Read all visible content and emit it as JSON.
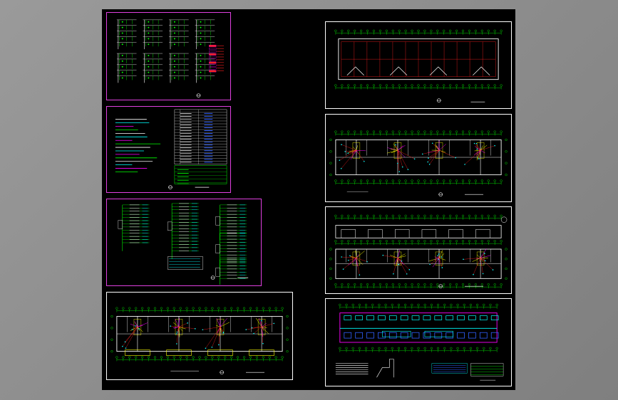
{
  "viewport": {
    "background_color": "#000000"
  },
  "colors": {
    "sheet_border_magenta": "#e040e0",
    "sheet_border_white": "#ffffff",
    "grid_green": "#00ff00",
    "wall_white": "#ffffff",
    "wire_red": "#ff2020",
    "wire_magenta": "#ff00ff",
    "wire_yellow": "#ffff00",
    "wire_cyan": "#00ffff",
    "wire_blue": "#3060ff"
  },
  "sheets": [
    {
      "id": "riser-diagram",
      "kind": "riser",
      "border": "magenta"
    },
    {
      "id": "legend-notes",
      "kind": "legend",
      "border": "magenta"
    },
    {
      "id": "distribution-boxes",
      "kind": "boxes",
      "border": "magenta"
    },
    {
      "id": "floor-plan-left",
      "kind": "plan",
      "border": "white"
    },
    {
      "id": "roof-plan",
      "kind": "roof",
      "border": "white"
    },
    {
      "id": "floor-plan-1",
      "kind": "plan",
      "border": "white"
    },
    {
      "id": "floor-plan-2",
      "kind": "plan2",
      "border": "white"
    },
    {
      "id": "foundation-plan",
      "kind": "foundation",
      "border": "white"
    }
  ]
}
